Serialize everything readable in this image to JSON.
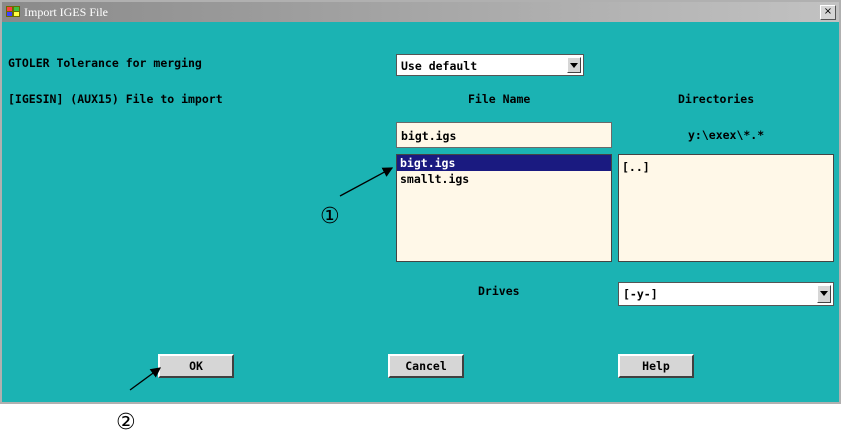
{
  "window": {
    "title": "Import IGES File",
    "close_symbol": "×"
  },
  "rows": {
    "tolerance_label": "GTOLER  Tolerance for merging",
    "tolerance_value": "Use default",
    "import_label": "[IGESIN] (AUX15)  File to import"
  },
  "file_section": {
    "file_name_header": "File Name",
    "directories_header": "Directories",
    "file_name_value": "bigt.igs",
    "current_path": "y:\\exex\\*.*",
    "files": [
      "bigt.igs",
      "smallt.igs"
    ],
    "directories": [
      "[..]"
    ]
  },
  "drives": {
    "label": "Drives",
    "value": "[-y-]"
  },
  "buttons": {
    "ok": "OK",
    "cancel": "Cancel",
    "help": "Help"
  },
  "annotations": {
    "callout_1": "①",
    "callout_2": "②"
  }
}
